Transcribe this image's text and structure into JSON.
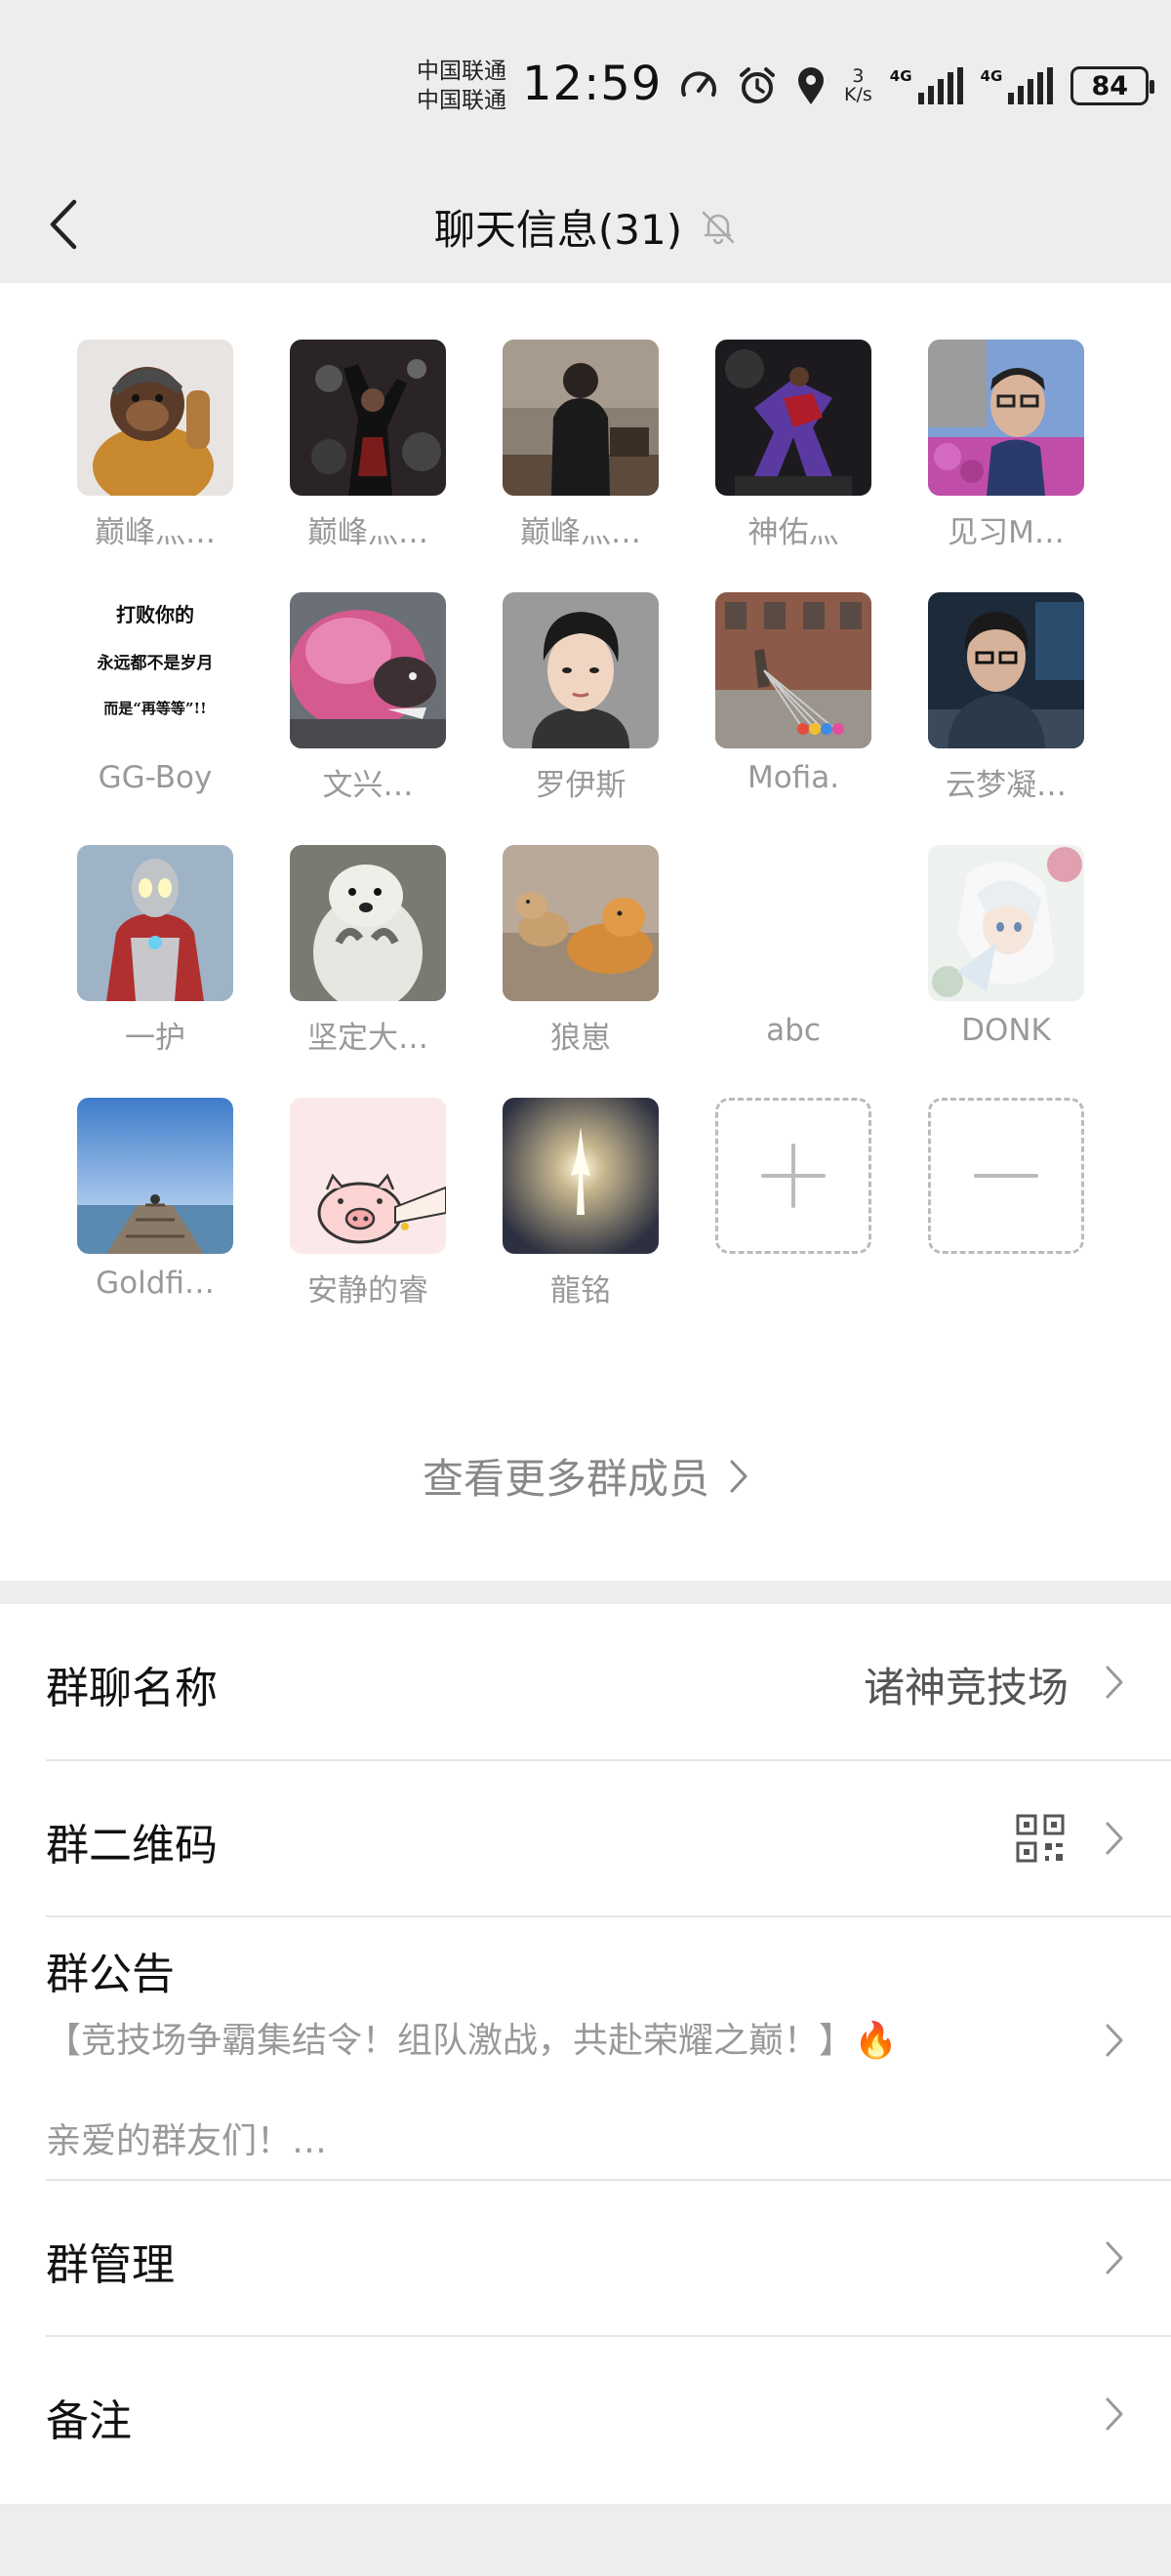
{
  "status_bar": {
    "carrier1": "中国联通",
    "carrier2": "中国联通",
    "time": "12:59",
    "net_speed_value": "3",
    "net_speed_unit": "K/s",
    "sig1_label": "4G",
    "sig2_label": "4G",
    "battery": "84",
    "icons": [
      "speedometer-icon",
      "alarm-icon",
      "location-icon",
      "signal-icon",
      "battery-icon"
    ]
  },
  "nav": {
    "title": "聊天信息(31)",
    "icons": [
      "back-icon",
      "mute-bell-icon"
    ]
  },
  "members": [
    {
      "name": "巅峰灬…"
    },
    {
      "name": "巅峰灬…"
    },
    {
      "name": "巅峰灬…"
    },
    {
      "name": "神佑灬"
    },
    {
      "name": "见习M…"
    },
    {
      "name": "GG-Boy",
      "avatar_text": [
        "打败你的",
        "永远都不是岁月",
        "而是“再等等”!!"
      ]
    },
    {
      "name": "文兴…"
    },
    {
      "name": "罗伊斯"
    },
    {
      "name": "Mofia."
    },
    {
      "name": "云梦凝…"
    },
    {
      "name": "一护"
    },
    {
      "name": "坚定大…"
    },
    {
      "name": "狼崽"
    },
    {
      "name": "abc"
    },
    {
      "name": "DONK"
    },
    {
      "name": "Goldfi…"
    },
    {
      "name": "安静的睿"
    },
    {
      "name": "龍铭"
    }
  ],
  "actions": {
    "add_icon": "plus-icon",
    "remove_icon": "minus-icon"
  },
  "more_members": "查看更多群成员",
  "settings": {
    "group_name_label": "群聊名称",
    "group_name_value": "诸神竞技场",
    "qr_label": "群二维码",
    "notice_label": "群公告",
    "notice_line1": "【竞技场争霸集结令！组队激战，共赴荣耀之巅！】🔥",
    "notice_line2": "亲爱的群友们！…",
    "manage_label": "群管理",
    "remark_label": "备注"
  }
}
